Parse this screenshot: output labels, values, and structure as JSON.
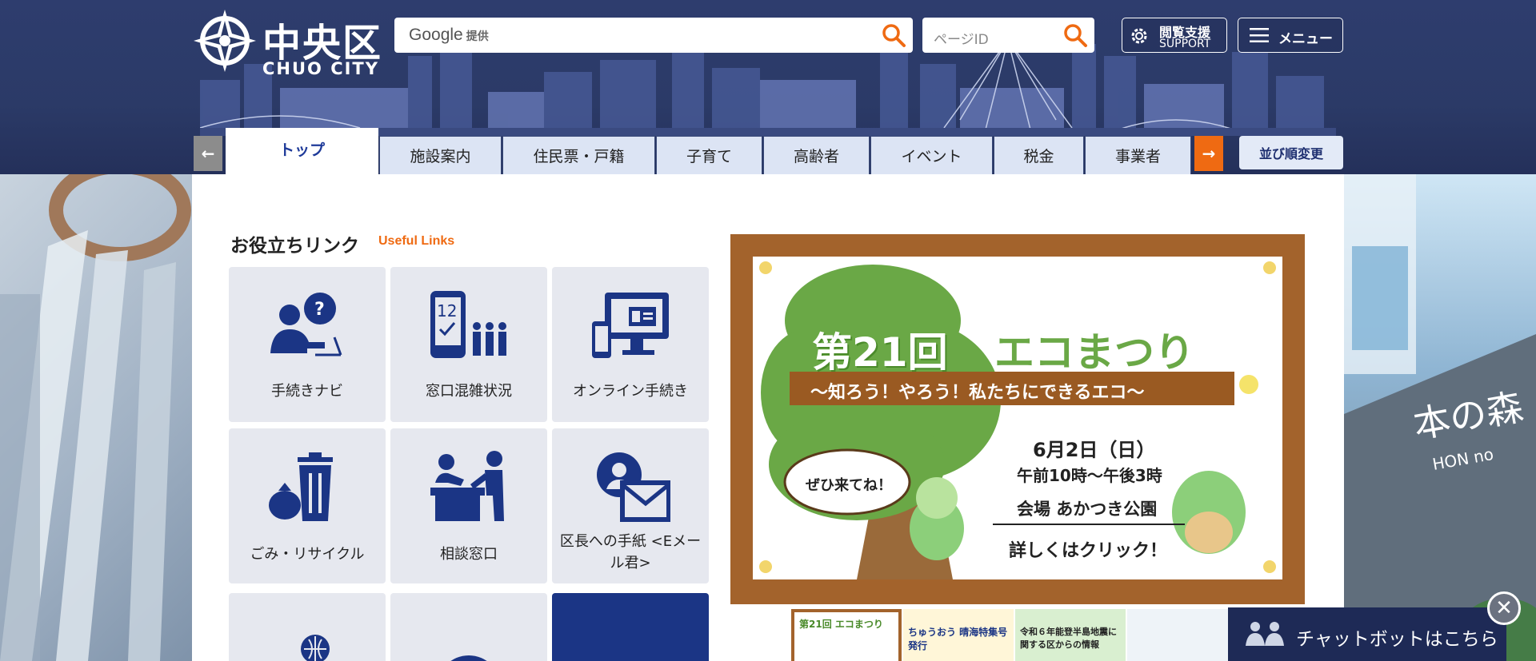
{
  "header": {
    "logo_title": "中央区",
    "logo_sub": "CHUO CITY",
    "search": {
      "provider": "Google",
      "provider_suffix": "提供",
      "page_id_placeholder": "ページID"
    },
    "support_label_1": "閲覧支援",
    "support_label_2": "SUPPORT",
    "menu_label": "メニュー"
  },
  "tabs": [
    {
      "label": "トップ",
      "active": true
    },
    {
      "label": "施設案内"
    },
    {
      "label": "住民票・戸籍"
    },
    {
      "label": "子育て"
    },
    {
      "label": "高齢者"
    },
    {
      "label": "イベント"
    },
    {
      "label": "税金"
    },
    {
      "label": "事業者"
    }
  ],
  "sort_label": "並び順変更",
  "useful_links": {
    "heading": "お役立ちリンク",
    "sub": "Useful Links",
    "tiles": [
      {
        "label": "手続きナビ",
        "icon": "procedure-navi-icon"
      },
      {
        "label": "窓口混雑状況",
        "icon": "counter-congestion-icon"
      },
      {
        "label": "オンライン手続き",
        "icon": "online-procedure-icon"
      },
      {
        "label": "ごみ・リサイクル",
        "icon": "garbage-recycle-icon"
      },
      {
        "label": "相談窓口",
        "icon": "consultation-icon"
      },
      {
        "label": "区長への手紙 <Eメール君>",
        "icon": "letter-mail-icon"
      }
    ]
  },
  "banner": {
    "title_1": "第21回",
    "title_2": "エコまつり",
    "subtitle": "〜知ろう！やろう！私たちにできるエコ〜",
    "speech": "ぜひ来てね！",
    "date": "6月2日（日）",
    "time": "午前10時〜午後3時",
    "venue": "会場 あかつき公園",
    "cta": "詳しくはクリック！"
  },
  "thumbs": [
    {
      "text": "第21回 エコまつり"
    },
    {
      "text": "ちゅうおう 晴海特集号発行"
    },
    {
      "text": "令和６年能登半島地震に関する区からの情報"
    },
    {
      "text": ""
    }
  ],
  "chatbot": {
    "label": "チャットボットはこちら",
    "close": "✕"
  },
  "colors": {
    "navy": "#2b3a67",
    "accent": "#ef6a12",
    "tile_bg": "#e6e8ef",
    "icon_blue": "#1b3585",
    "banner_frame": "#a3632c"
  }
}
